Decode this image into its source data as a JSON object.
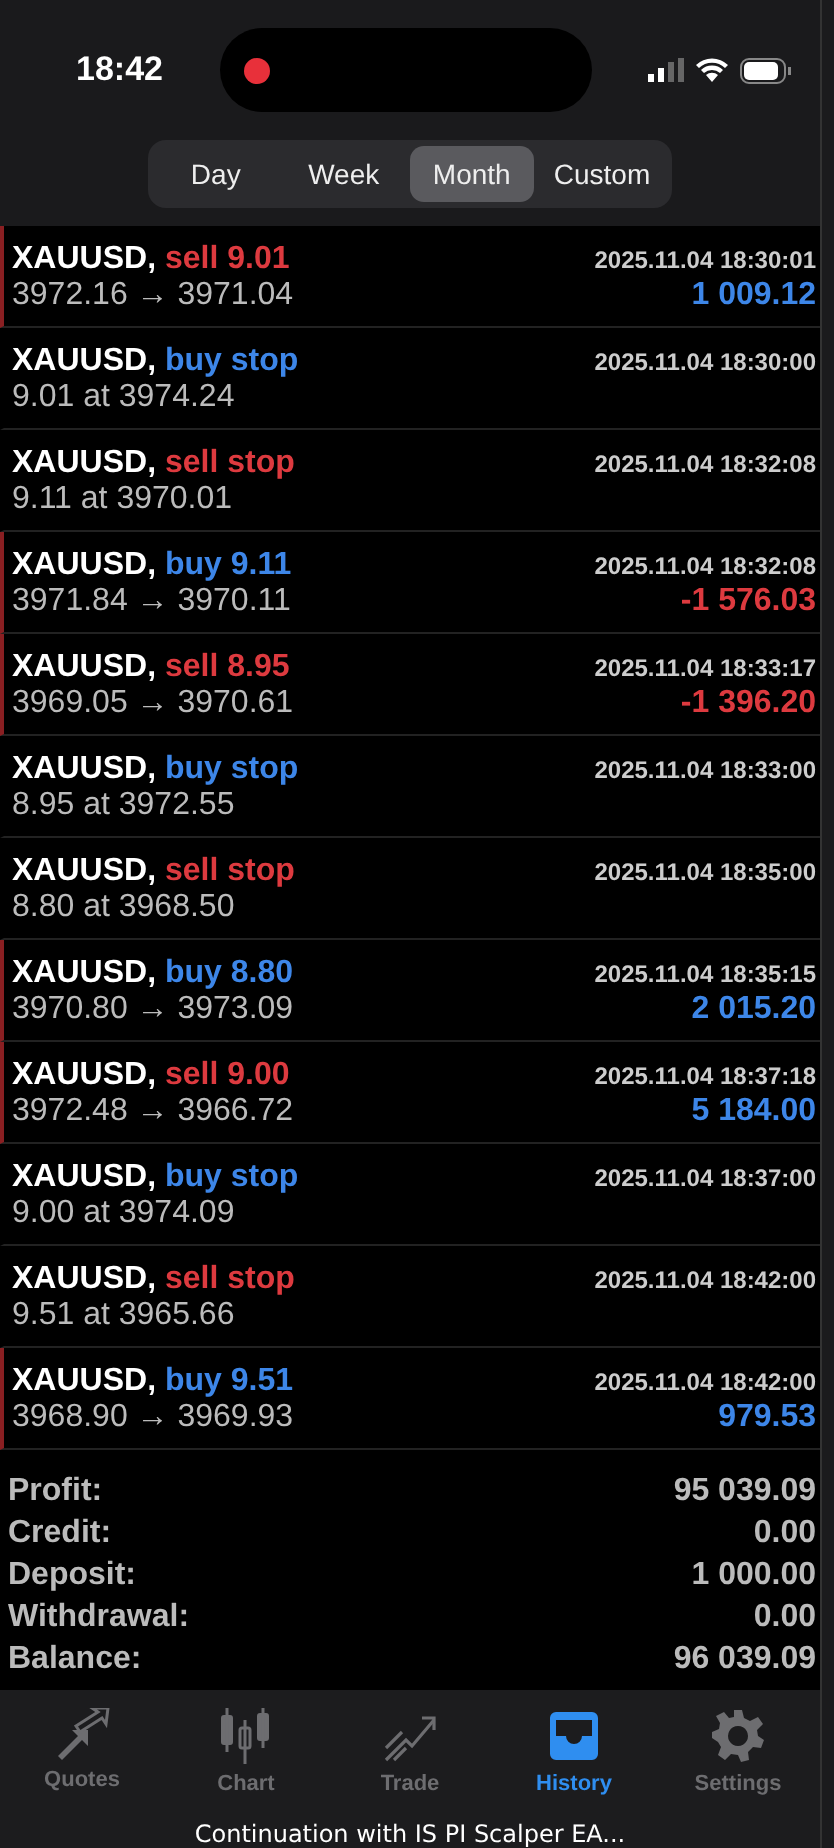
{
  "status_bar": {
    "time": "18:42",
    "recording": true
  },
  "period_tabs": [
    {
      "label": "Day",
      "selected": false
    },
    {
      "label": "Week",
      "selected": false
    },
    {
      "label": "Month",
      "selected": true
    },
    {
      "label": "Custom",
      "selected": false
    }
  ],
  "history": [
    {
      "kind": "deal",
      "symbol": "XAUUSD,",
      "color": "#dd3a3f",
      "action": "sell 9.01",
      "time": "2025.11.04 18:30:01",
      "detail": "3972.16 → 3971.04",
      "profit": "1 009.12",
      "negative": false
    },
    {
      "kind": "order",
      "symbol": "XAUUSD,",
      "color": "#3d86e8",
      "action": "buy stop",
      "time": "2025.11.04 18:30:00",
      "detail": "9.01 at 3974.24"
    },
    {
      "kind": "order",
      "symbol": "XAUUSD,",
      "color": "#dd3a3f",
      "action": "sell stop",
      "time": "2025.11.04 18:32:08",
      "detail": "9.11 at 3970.01"
    },
    {
      "kind": "deal",
      "symbol": "XAUUSD,",
      "color": "#3d86e8",
      "action": "buy 9.11",
      "time": "2025.11.04 18:32:08",
      "detail": "3971.84 → 3970.11",
      "profit": "-1 576.03",
      "negative": true
    },
    {
      "kind": "deal",
      "symbol": "XAUUSD,",
      "color": "#dd3a3f",
      "action": "sell 8.95",
      "time": "2025.11.04 18:33:17",
      "detail": "3969.05 → 3970.61",
      "profit": "-1 396.20",
      "negative": true
    },
    {
      "kind": "order",
      "symbol": "XAUUSD,",
      "color": "#3d86e8",
      "action": "buy stop",
      "time": "2025.11.04 18:33:00",
      "detail": "8.95 at 3972.55"
    },
    {
      "kind": "order",
      "symbol": "XAUUSD,",
      "color": "#dd3a3f",
      "action": "sell stop",
      "time": "2025.11.04 18:35:00",
      "detail": "8.80 at 3968.50"
    },
    {
      "kind": "deal",
      "symbol": "XAUUSD,",
      "color": "#3d86e8",
      "action": "buy 8.80",
      "time": "2025.11.04 18:35:15",
      "detail": "3970.80 → 3973.09",
      "profit": "2 015.20",
      "negative": false
    },
    {
      "kind": "deal",
      "symbol": "XAUUSD,",
      "color": "#dd3a3f",
      "action": "sell 9.00",
      "time": "2025.11.04 18:37:18",
      "detail": "3972.48 → 3966.72",
      "profit": "5 184.00",
      "negative": false
    },
    {
      "kind": "order",
      "symbol": "XAUUSD,",
      "color": "#3d86e8",
      "action": "buy stop",
      "time": "2025.11.04 18:37:00",
      "detail": "9.00 at 3974.09"
    },
    {
      "kind": "order",
      "symbol": "XAUUSD,",
      "color": "#dd3a3f",
      "action": "sell stop",
      "time": "2025.11.04 18:42:00",
      "detail": "9.51 at 3965.66"
    },
    {
      "kind": "deal",
      "symbol": "XAUUSD,",
      "color": "#3d86e8",
      "action": "buy 9.51",
      "time": "2025.11.04 18:42:00",
      "detail": "3968.90 → 3969.93",
      "profit": "979.53",
      "negative": false
    }
  ],
  "summary": [
    {
      "label": "Profit:",
      "value": "95 039.09"
    },
    {
      "label": "Credit:",
      "value": "0.00"
    },
    {
      "label": "Deposit:",
      "value": "1 000.00"
    },
    {
      "label": "Withdrawal:",
      "value": "0.00"
    },
    {
      "label": "Balance:",
      "value": "96 039.09"
    }
  ],
  "tab_bar": [
    {
      "kind": "quotes",
      "label": "Quotes",
      "selected": false
    },
    {
      "kind": "chart",
      "label": "Chart",
      "selected": false
    },
    {
      "kind": "trade",
      "label": "Trade",
      "selected": false
    },
    {
      "kind": "history",
      "label": "History",
      "selected": true
    },
    {
      "kind": "settings",
      "label": "Settings",
      "selected": false
    }
  ],
  "caption": "Continuation with IS PI Scalper EA..."
}
